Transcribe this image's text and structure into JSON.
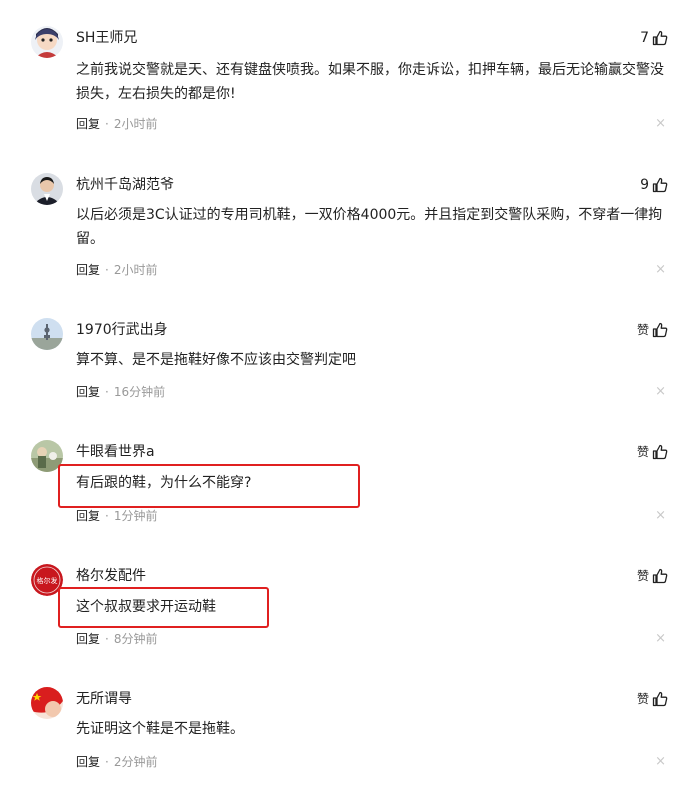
{
  "comments": [
    {
      "username": "SH王师兄",
      "likes": "7",
      "content": "之前我说交警就是天、还有键盘侠喷我。如果不服，你走诉讼，扣押车辆，最后无论输赢交警没损失，左右损失的都是你!",
      "reply": "回复",
      "time": "2小时前"
    },
    {
      "username": "杭州千岛湖范爷",
      "likes": "9",
      "content": "以后必须是3C认证过的专用司机鞋，一双价格4000元。并且指定到交警队采购，不穿者一律拘留。",
      "reply": "回复",
      "time": "2小时前"
    },
    {
      "username": "1970行武出身",
      "likes": "赞",
      "content": "算不算、是不是拖鞋好像不应该由交警判定吧",
      "reply": "回复",
      "time": "16分钟前"
    },
    {
      "username": "牛眼看世界a",
      "likes": "赞",
      "content": "有后跟的鞋，为什么不能穿?",
      "reply": "回复",
      "time": "1分钟前"
    },
    {
      "username": "格尔发配件",
      "avatar_text": "格尔发",
      "likes": "赞",
      "content": "这个叔叔要求开运动鞋",
      "reply": "回复",
      "time": "8分钟前"
    },
    {
      "username": "无所谓㝵",
      "likes": "赞",
      "content": "先证明这个鞋是不是拖鞋。",
      "reply": "回复",
      "time": "2分钟前"
    }
  ],
  "icons": {
    "like": "thumbs-up-icon",
    "close": "close-icon"
  },
  "glyphs": {
    "close": "×",
    "separator": "·"
  },
  "colors": {
    "highlight_box": "#e02020",
    "meta_text": "#999999",
    "primary_text": "#222222"
  }
}
